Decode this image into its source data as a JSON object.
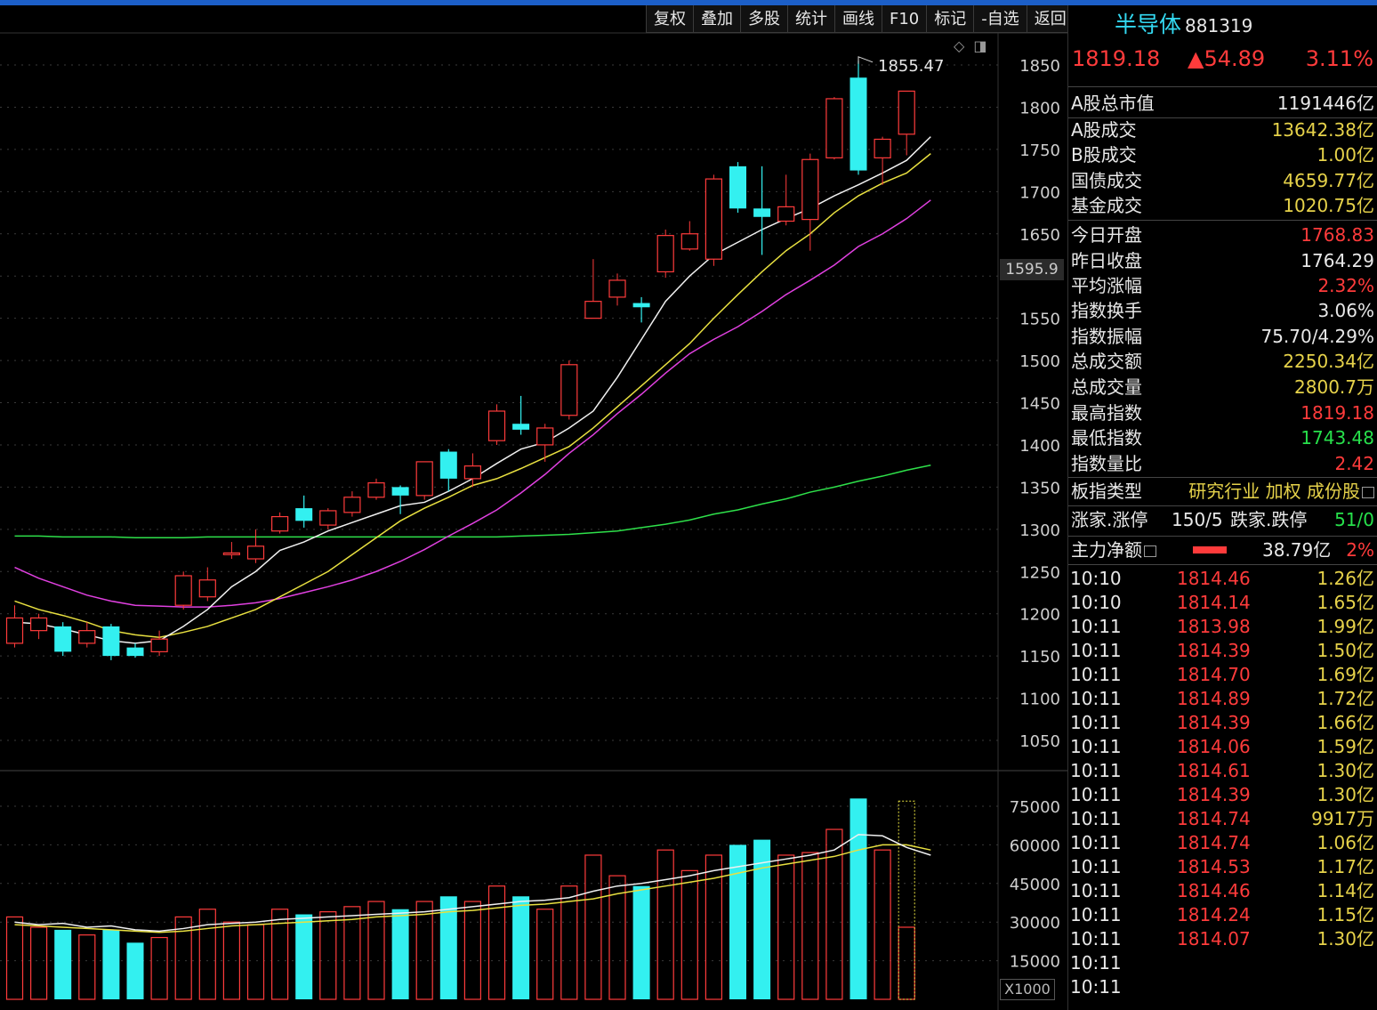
{
  "toolbar": {
    "buttons": [
      "复权",
      "叠加",
      "多股",
      "统计",
      "画线",
      "F10",
      "标记",
      "-自选",
      "返回"
    ]
  },
  "icons": {
    "diamond": "diamond-icon",
    "panel_toggle": "panel-toggle-icon"
  },
  "header": {
    "name": "半导体",
    "code": "881319",
    "price": "1819.18",
    "change": "▲54.89",
    "change_pct": "3.11%"
  },
  "stats": [
    {
      "label": "A股总市值",
      "value": "1191446亿",
      "color": "white"
    },
    {
      "label": "A股成交",
      "value": "13642.38亿",
      "color": "yellow"
    },
    {
      "label": "B股成交",
      "value": "1.00亿",
      "color": "yellow"
    },
    {
      "label": "国债成交",
      "value": "4659.77亿",
      "color": "yellow"
    },
    {
      "label": "基金成交",
      "value": "1020.75亿",
      "color": "yellow"
    },
    {
      "label": "今日开盘",
      "value": "1768.83",
      "color": "red"
    },
    {
      "label": "昨日收盘",
      "value": "1764.29",
      "color": "white"
    },
    {
      "label": "平均涨幅",
      "value": "2.32%",
      "color": "red"
    },
    {
      "label": "指数换手",
      "value": "3.06%",
      "color": "white"
    },
    {
      "label": "指数振幅",
      "value": "75.70/4.29%",
      "color": "white"
    },
    {
      "label": "总成交额",
      "value": "2250.34亿",
      "color": "yellow"
    },
    {
      "label": "总成交量",
      "value": "2800.7万",
      "color": "yellow"
    },
    {
      "label": "最高指数",
      "value": "1819.18",
      "color": "red"
    },
    {
      "label": "最低指数",
      "value": "1743.48",
      "color": "green"
    },
    {
      "label": "指数量比",
      "value": "2.42",
      "color": "red"
    }
  ],
  "board": {
    "label": "板指类型",
    "value": "研究行业 加权 成份股"
  },
  "updown": {
    "up_label": "涨家.涨停",
    "up_value": "150/5",
    "down_label": "跌家.跌停",
    "down_value": "51/0"
  },
  "mainflow": {
    "label": "主力净额",
    "value": "38.79亿",
    "pct": "2%"
  },
  "ticks": [
    {
      "time": "10:10",
      "price": "1814.46",
      "amount": "1.26亿"
    },
    {
      "time": "10:10",
      "price": "1814.14",
      "amount": "1.65亿"
    },
    {
      "time": "10:11",
      "price": "1813.98",
      "amount": "1.99亿"
    },
    {
      "time": "10:11",
      "price": "1814.39",
      "amount": "1.50亿"
    },
    {
      "time": "10:11",
      "price": "1814.70",
      "amount": "1.69亿"
    },
    {
      "time": "10:11",
      "price": "1814.89",
      "amount": "1.72亿"
    },
    {
      "time": "10:11",
      "price": "1814.39",
      "amount": "1.66亿"
    },
    {
      "time": "10:11",
      "price": "1814.06",
      "amount": "1.59亿"
    },
    {
      "time": "10:11",
      "price": "1814.61",
      "amount": "1.30亿"
    },
    {
      "time": "10:11",
      "price": "1814.39",
      "amount": "1.30亿"
    },
    {
      "time": "10:11",
      "price": "1814.74",
      "amount": "9917万"
    },
    {
      "time": "10:11",
      "price": "1814.74",
      "amount": "1.06亿"
    },
    {
      "time": "10:11",
      "price": "1814.53",
      "amount": "1.17亿"
    },
    {
      "time": "10:11",
      "price": "1814.46",
      "amount": "1.14亿"
    },
    {
      "time": "10:11",
      "price": "1814.24",
      "amount": "1.15亿"
    },
    {
      "time": "10:11",
      "price": "1814.07",
      "amount": "1.30亿"
    },
    {
      "time": "10:11",
      "price": "",
      "amount": ""
    },
    {
      "time": "10:11",
      "price": "",
      "amount": ""
    }
  ],
  "chart_data": {
    "type": "candlestick",
    "price_ticks": [
      1850,
      1800,
      1750,
      1700,
      1650,
      1600,
      1550,
      1500,
      1450,
      1400,
      1350,
      1300,
      1250,
      1200,
      1150,
      1100,
      1050
    ],
    "price_ticks_shown": [
      "1850",
      "1800",
      "1750",
      "1700",
      "1650",
      "",
      "1550",
      "1500",
      "1450",
      "1400",
      "1350",
      "1300",
      "1250",
      "1200",
      "1150",
      "1100",
      "1050"
    ],
    "ylim": [
      1010,
      1880
    ],
    "current_price_label": "1595.9",
    "high_marker": "1855.47",
    "volume_ticks": [
      "75000",
      "60000",
      "45000",
      "30000",
      "15000"
    ],
    "volume_ticks_values": [
      75000,
      60000,
      45000,
      30000,
      15000
    ],
    "volume_ylim": [
      0,
      80000
    ],
    "volume_unit": "X1000",
    "candles": [
      {
        "o": 1165,
        "c": 1195,
        "h": 1210,
        "l": 1160,
        "v": 32000
      },
      {
        "o": 1180,
        "c": 1195,
        "h": 1200,
        "l": 1170,
        "v": 28000
      },
      {
        "o": 1185,
        "c": 1155,
        "h": 1190,
        "l": 1150,
        "v": 27000
      },
      {
        "o": 1165,
        "c": 1180,
        "h": 1190,
        "l": 1160,
        "v": 25000
      },
      {
        "o": 1185,
        "c": 1150,
        "h": 1188,
        "l": 1145,
        "v": 27000
      },
      {
        "o": 1160,
        "c": 1150,
        "h": 1165,
        "l": 1148,
        "v": 22000
      },
      {
        "o": 1155,
        "c": 1170,
        "h": 1180,
        "l": 1150,
        "v": 24000
      },
      {
        "o": 1210,
        "c": 1245,
        "h": 1250,
        "l": 1205,
        "v": 32000
      },
      {
        "o": 1220,
        "c": 1240,
        "h": 1255,
        "l": 1215,
        "v": 35000
      },
      {
        "o": 1270,
        "c": 1272,
        "h": 1285,
        "l": 1265,
        "v": 30000
      },
      {
        "o": 1265,
        "c": 1280,
        "h": 1300,
        "l": 1260,
        "v": 29000
      },
      {
        "o": 1298,
        "c": 1315,
        "h": 1320,
        "l": 1295,
        "v": 35000
      },
      {
        "o": 1325,
        "c": 1310,
        "h": 1340,
        "l": 1302,
        "v": 33000
      },
      {
        "o": 1305,
        "c": 1322,
        "h": 1325,
        "l": 1300,
        "v": 34000
      },
      {
        "o": 1320,
        "c": 1338,
        "h": 1345,
        "l": 1315,
        "v": 36000
      },
      {
        "o": 1338,
        "c": 1355,
        "h": 1360,
        "l": 1335,
        "v": 38000
      },
      {
        "o": 1350,
        "c": 1340,
        "h": 1352,
        "l": 1318,
        "v": 35000
      },
      {
        "o": 1340,
        "c": 1380,
        "h": 1380,
        "l": 1335,
        "v": 38000
      },
      {
        "o": 1392,
        "c": 1360,
        "h": 1395,
        "l": 1345,
        "v": 40000
      },
      {
        "o": 1360,
        "c": 1375,
        "h": 1390,
        "l": 1350,
        "v": 38000
      },
      {
        "o": 1405,
        "c": 1440,
        "h": 1448,
        "l": 1400,
        "v": 44000
      },
      {
        "o": 1425,
        "c": 1418,
        "h": 1458,
        "l": 1412,
        "v": 40000
      },
      {
        "o": 1400,
        "c": 1420,
        "h": 1425,
        "l": 1380,
        "v": 35000
      },
      {
        "o": 1435,
        "c": 1495,
        "h": 1500,
        "l": 1430,
        "v": 44000
      },
      {
        "o": 1550,
        "c": 1570,
        "h": 1620,
        "l": 1550,
        "v": 56000
      },
      {
        "o": 1575,
        "c": 1595,
        "h": 1603,
        "l": 1565,
        "v": 48000
      },
      {
        "o": 1568,
        "c": 1563,
        "h": 1575,
        "l": 1545,
        "v": 44000
      },
      {
        "o": 1605,
        "c": 1648,
        "h": 1655,
        "l": 1598,
        "v": 58000
      },
      {
        "o": 1632,
        "c": 1650,
        "h": 1665,
        "l": 1630,
        "v": 50000
      },
      {
        "o": 1620,
        "c": 1715,
        "h": 1720,
        "l": 1612,
        "v": 56000
      },
      {
        "o": 1730,
        "c": 1680,
        "h": 1735,
        "l": 1675,
        "v": 60000
      },
      {
        "o": 1680,
        "c": 1670,
        "h": 1730,
        "l": 1625,
        "v": 62000
      },
      {
        "o": 1665,
        "c": 1682,
        "h": 1720,
        "l": 1660,
        "v": 56000
      },
      {
        "o": 1667,
        "c": 1738,
        "h": 1745,
        "l": 1630,
        "v": 57000
      },
      {
        "o": 1740,
        "c": 1810,
        "h": 1812,
        "l": 1738,
        "v": 66000
      },
      {
        "o": 1835,
        "c": 1725,
        "h": 1855,
        "l": 1720,
        "v": 78000
      },
      {
        "o": 1740,
        "c": 1762,
        "h": 1765,
        "l": 1708,
        "v": 58000
      },
      {
        "o": 1768,
        "c": 1819,
        "h": 1819,
        "l": 1743,
        "v": 28000
      }
    ],
    "ma_white": [
      1190,
      1188,
      1182,
      1175,
      1168,
      1165,
      1168,
      1185,
      1205,
      1232,
      1250,
      1275,
      1285,
      1298,
      1308,
      1318,
      1328,
      1332,
      1345,
      1360,
      1378,
      1395,
      1403,
      1420,
      1440,
      1480,
      1525,
      1570,
      1600,
      1625,
      1640,
      1655,
      1668,
      1680,
      1695,
      1708,
      1722,
      1737,
      1765
    ],
    "ma_yellow": [
      1215,
      1205,
      1198,
      1190,
      1180,
      1175,
      1172,
      1178,
      1185,
      1195,
      1205,
      1220,
      1235,
      1250,
      1270,
      1290,
      1310,
      1325,
      1338,
      1352,
      1360,
      1372,
      1385,
      1398,
      1420,
      1445,
      1470,
      1495,
      1520,
      1550,
      1578,
      1605,
      1630,
      1650,
      1675,
      1695,
      1710,
      1722,
      1745
    ],
    "ma_magenta": [
      1255,
      1242,
      1232,
      1222,
      1215,
      1210,
      1209,
      1208,
      1208,
      1210,
      1213,
      1218,
      1225,
      1232,
      1240,
      1250,
      1262,
      1276,
      1292,
      1307,
      1323,
      1343,
      1365,
      1390,
      1412,
      1437,
      1460,
      1485,
      1508,
      1525,
      1540,
      1558,
      1578,
      1595,
      1613,
      1635,
      1650,
      1668,
      1690
    ],
    "ma_green": [
      1292,
      1292,
      1291,
      1291,
      1291,
      1290,
      1290,
      1290,
      1291,
      1291,
      1291,
      1291,
      1291,
      1291,
      1291,
      1291,
      1291,
      1291,
      1291,
      1291,
      1291,
      1292,
      1293,
      1294,
      1296,
      1298,
      1302,
      1306,
      1311,
      1318,
      1323,
      1330,
      1336,
      1344,
      1350,
      1357,
      1363,
      1370,
      1376
    ],
    "vma_white": [
      30000,
      29000,
      29500,
      28000,
      28500,
      27000,
      26500,
      27500,
      29000,
      29500,
      30000,
      31000,
      31500,
      32000,
      32500,
      33000,
      33500,
      34000,
      35000,
      36000,
      37000,
      38000,
      38500,
      39500,
      42000,
      44000,
      45000,
      46500,
      48000,
      50000,
      51500,
      53000,
      54500,
      56000,
      58000,
      64000,
      63500,
      59000,
      56000
    ],
    "vma_yellow": [
      29000,
      28500,
      28000,
      27500,
      27000,
      26500,
      26000,
      26500,
      27500,
      28500,
      29000,
      29500,
      30000,
      30500,
      31000,
      32000,
      32500,
      33000,
      34000,
      34500,
      35500,
      36500,
      37000,
      38000,
      39000,
      41000,
      42500,
      44000,
      45500,
      47000,
      49000,
      51000,
      52500,
      54000,
      55500,
      58000,
      60000,
      60000,
      58000
    ]
  }
}
